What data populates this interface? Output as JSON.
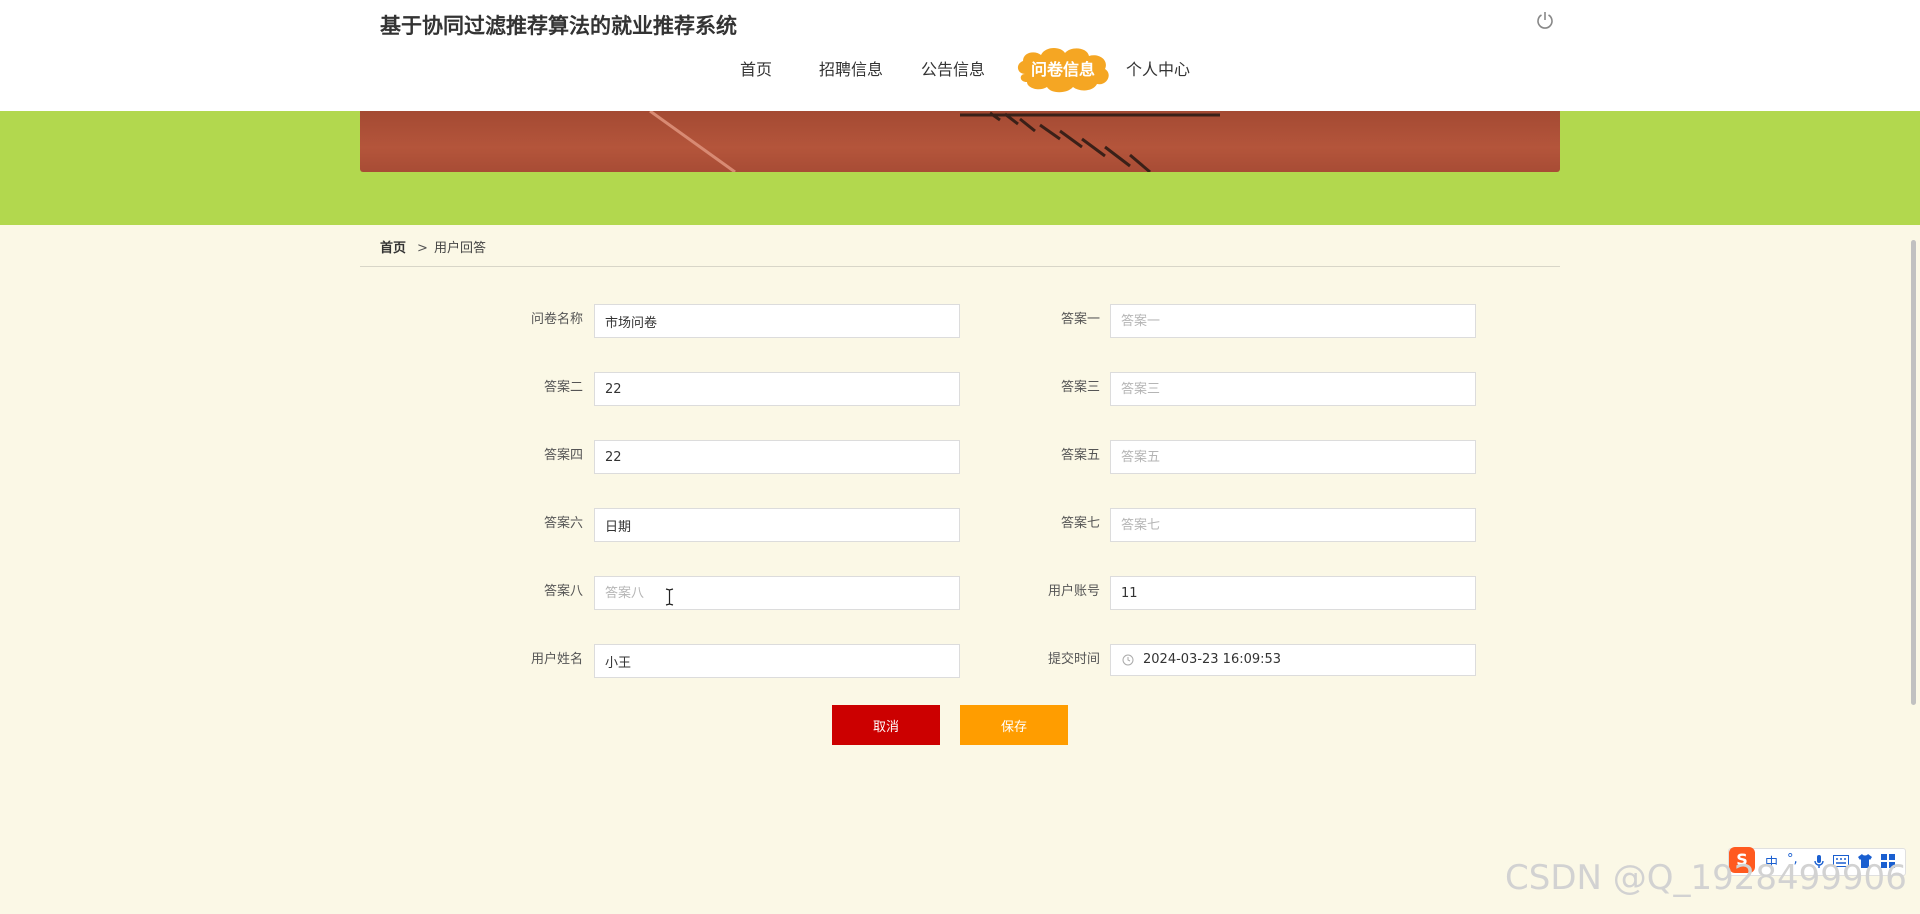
{
  "header": {
    "site_title": "基于协同过滤推荐算法的就业推荐系统",
    "nav": [
      {
        "label": "首页"
      },
      {
        "label": "招聘信息"
      },
      {
        "label": "公告信息"
      },
      {
        "label": "问卷信息",
        "active": true
      },
      {
        "label": "个人中心"
      }
    ],
    "logout_icon": "power-icon"
  },
  "breadcrumb": {
    "home": "首页",
    "separator": ">",
    "current": "用户回答"
  },
  "form": {
    "questionnaire_name": {
      "label": "问卷名称",
      "value": "市场问卷",
      "placeholder": ""
    },
    "answer1": {
      "label": "答案一",
      "value": "",
      "placeholder": "答案一"
    },
    "answer2": {
      "label": "答案二",
      "value": "22",
      "placeholder": ""
    },
    "answer3": {
      "label": "答案三",
      "value": "",
      "placeholder": "答案三"
    },
    "answer4": {
      "label": "答案四",
      "value": "22",
      "placeholder": ""
    },
    "answer5": {
      "label": "答案五",
      "value": "",
      "placeholder": "答案五"
    },
    "answer6": {
      "label": "答案六",
      "value": "日期",
      "placeholder": ""
    },
    "answer7": {
      "label": "答案七",
      "value": "",
      "placeholder": "答案七"
    },
    "answer8": {
      "label": "答案八",
      "value": "",
      "placeholder": "答案八"
    },
    "user_account": {
      "label": "用户账号",
      "value": "11",
      "placeholder": ""
    },
    "user_name": {
      "label": "用户姓名",
      "value": "小王",
      "placeholder": ""
    },
    "submit_time": {
      "label": "提交时间",
      "value": "2024-03-23 16:09:53",
      "placeholder": ""
    },
    "cancel_label": "取消",
    "save_label": "保存"
  },
  "ime": {
    "logo": "S",
    "mode": "中",
    "punct": "°,",
    "icons": [
      "mic-icon",
      "keyboard-icon",
      "skin-icon",
      "grid-icon"
    ]
  },
  "watermark": "CSDN @Q_1928499906",
  "colors": {
    "banner_green": "#b2d84e",
    "nav_active": "#f5a623",
    "cancel": "#cc0000",
    "save": "#ff9d00",
    "page_bg": "#fbf8e6"
  }
}
